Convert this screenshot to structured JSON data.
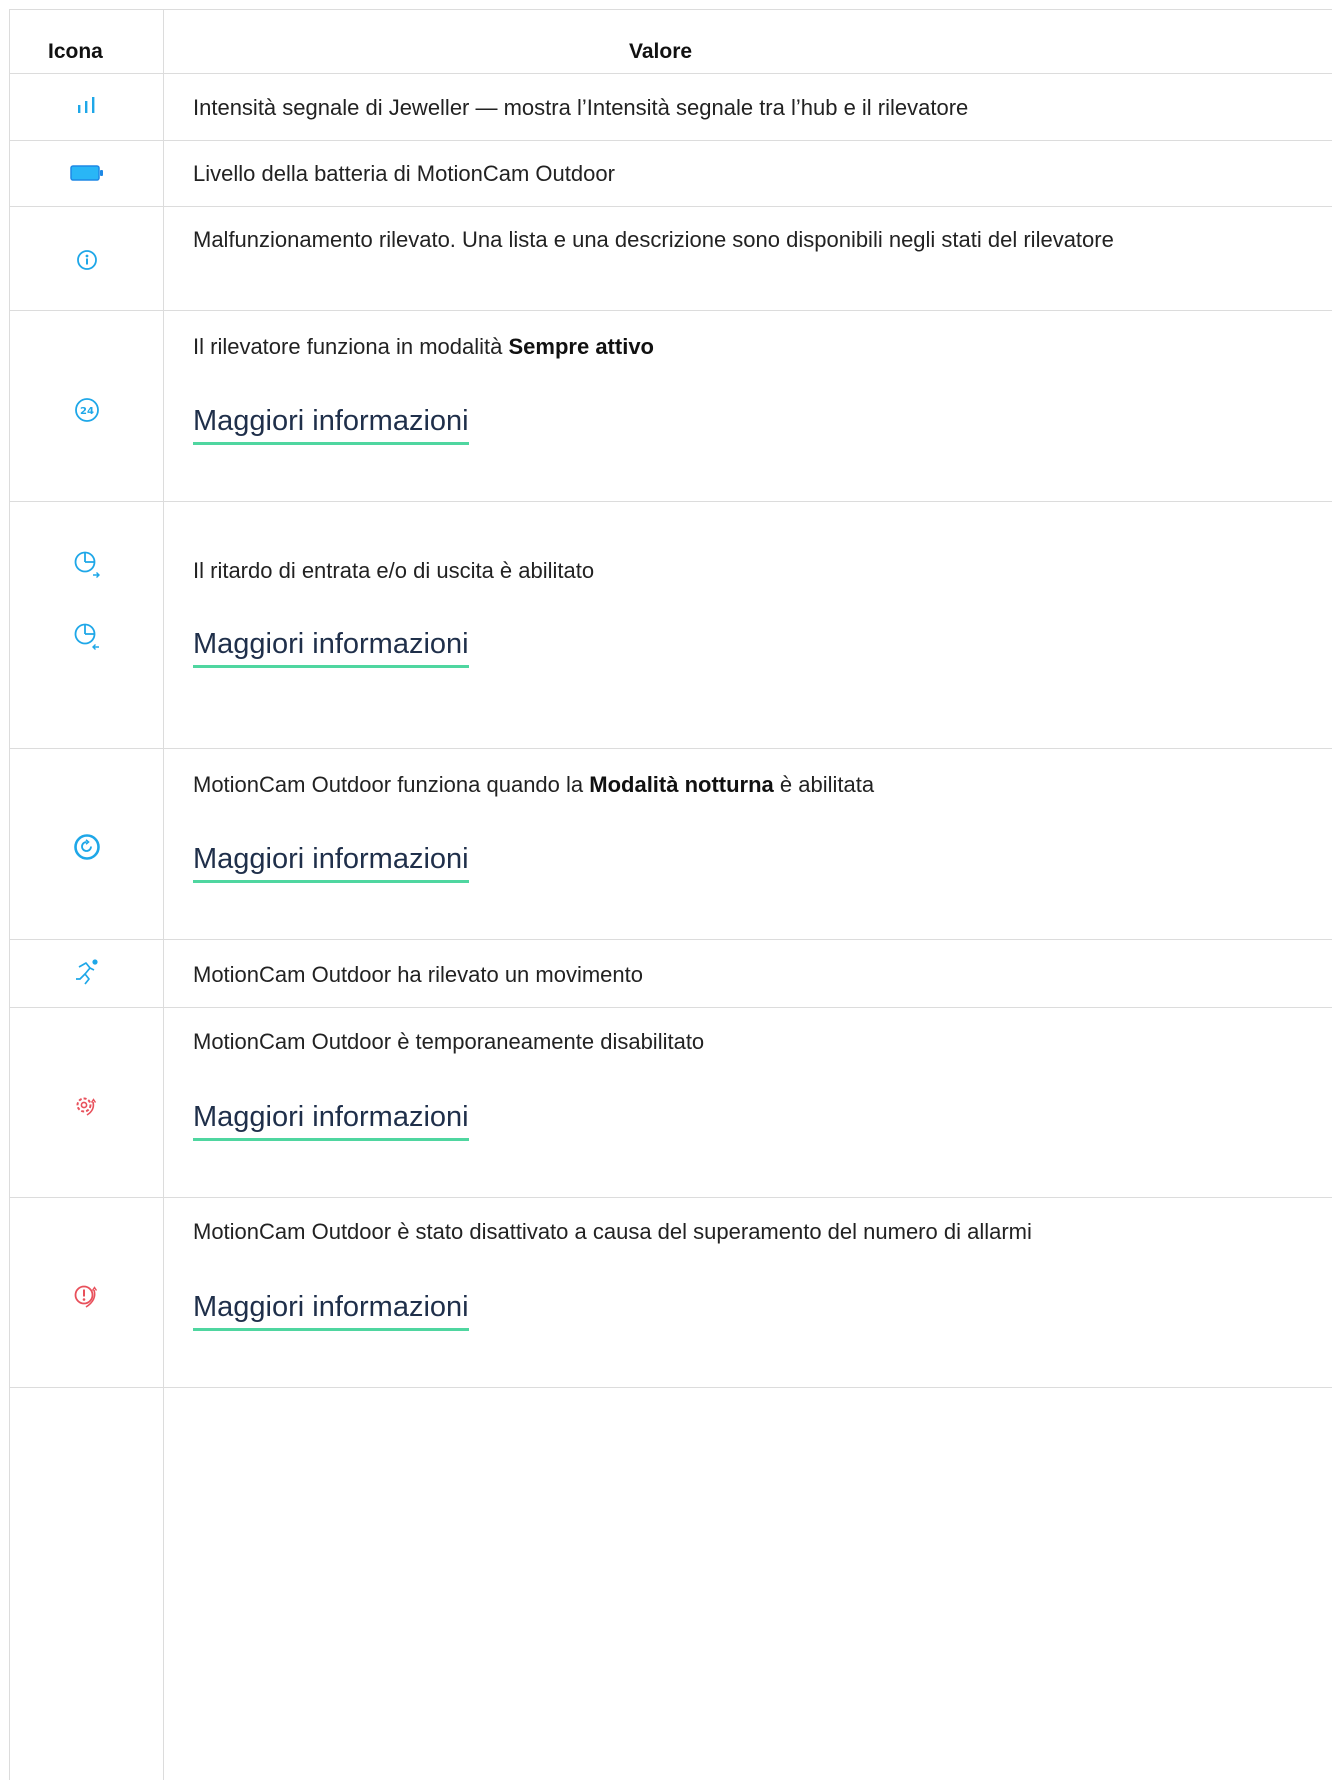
{
  "header": {
    "icon_col": "Icona",
    "value_col": "Valore"
  },
  "rows": [
    {
      "icon": "signal-strength-icon",
      "text": "Intensità segnale di Jeweller — mostra l’Intensità segnale tra l’hub e il rilevatore"
    },
    {
      "icon": "battery-icon",
      "text": "Livello della batteria di MotionCam Outdoor"
    },
    {
      "icon": "info-icon",
      "text": "Malfunzionamento rilevato. Una lista e una descrizione sono disponibili negli stati del rilevatore"
    },
    {
      "icon": "always-active-24-icon",
      "text_before": "Il rilevatore funziona in modalità ",
      "text_bold": "Sempre attivo",
      "text_after": "",
      "link": "Maggiori informazioni"
    },
    {
      "icon": "entry-exit-delay-icon",
      "text": "Il ritardo di entrata e/o di uscita è abilitato",
      "link": "Maggiori informazioni"
    },
    {
      "icon": "night-mode-icon",
      "text_before": "MotionCam Outdoor funziona quando la ",
      "text_bold": "Modalità notturna",
      "text_after": " è abilitata",
      "link": "Maggiori informazioni"
    },
    {
      "icon": "motion-detected-icon",
      "text": "MotionCam Outdoor ha rilevato un movimento"
    },
    {
      "icon": "temporarily-disabled-icon",
      "text": "MotionCam Outdoor è temporaneamente disabilitato",
      "link": "Maggiori informazioni"
    },
    {
      "icon": "alarm-limit-disabled-icon",
      "text": "MotionCam Outdoor è stato disattivato a causa del superamento del numero di allarmi",
      "link": "Maggiori informazioni"
    }
  ],
  "colors": {
    "accent_blue": "#1ea7e8",
    "alert_red": "#e8505b",
    "link_underline": "#4fd6a0"
  }
}
